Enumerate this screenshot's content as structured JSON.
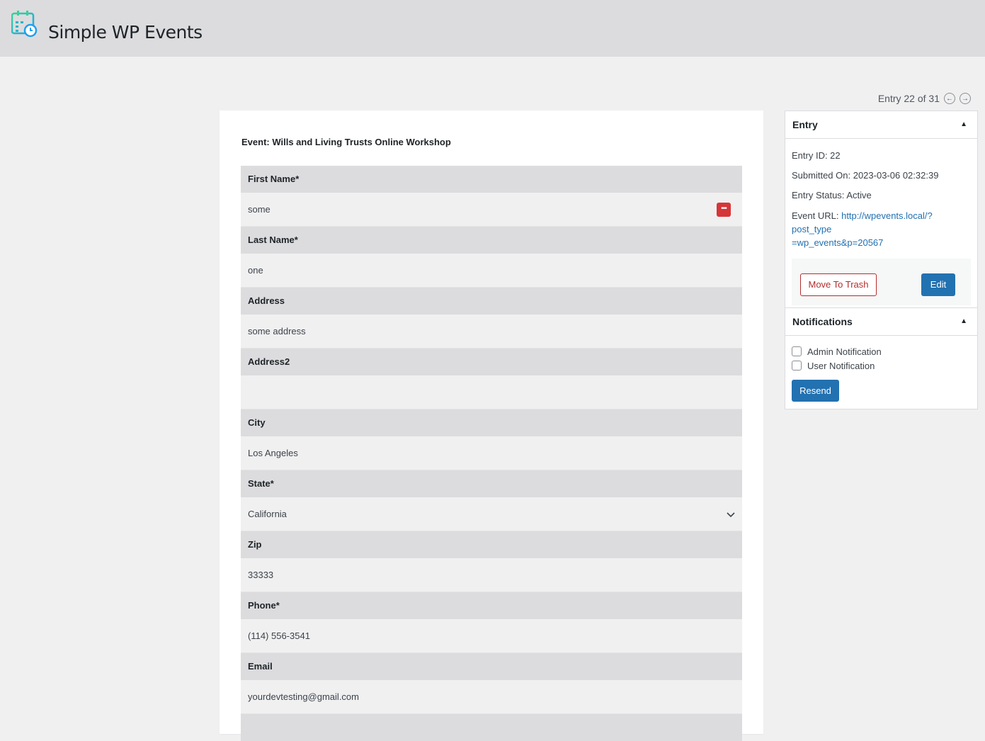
{
  "header": {
    "app_title": "Simple WP Events",
    "logo_icon": "calendar-clock-icon"
  },
  "pager": {
    "text": "Entry 22 of 31",
    "prev_icon": "arrow-left-circle-icon",
    "next_icon": "arrow-right-circle-icon"
  },
  "form": {
    "event_title": "Event: Wills and Living Trusts Online Workshop",
    "fields": [
      {
        "label": "First Name*",
        "value": "some"
      },
      {
        "label": "Last Name*",
        "value": "one"
      },
      {
        "label": "Address",
        "value": "some address"
      },
      {
        "label": "Address2",
        "value": ""
      },
      {
        "label": "City",
        "value": "Los Angeles"
      },
      {
        "label": "State*",
        "value": "California"
      },
      {
        "label": "Zip",
        "value": "33333"
      },
      {
        "label": "Phone*",
        "value": "(114) 556-3541"
      },
      {
        "label": "Email",
        "value": "yourdevtesting@gmail.com"
      }
    ]
  },
  "entry_box": {
    "title": "Entry",
    "entry_id": "Entry ID: 22",
    "submitted_on": "Submitted On: 2023-03-06 02:32:39",
    "status": "Entry Status: Active",
    "url_label": "Event URL: ",
    "url_line1": "http://wpevents.local/?post_type",
    "url_line2": "=wp_events&p=20567",
    "trash_label": "Move To Trash",
    "edit_label": "Edit"
  },
  "notifications_box": {
    "title": "Notifications",
    "admin_label": "Admin Notification",
    "user_label": "User Notification",
    "resend_label": "Resend"
  },
  "colors": {
    "primary": "#2271b1",
    "danger": "#b32d2e",
    "red_badge": "#d63638"
  }
}
